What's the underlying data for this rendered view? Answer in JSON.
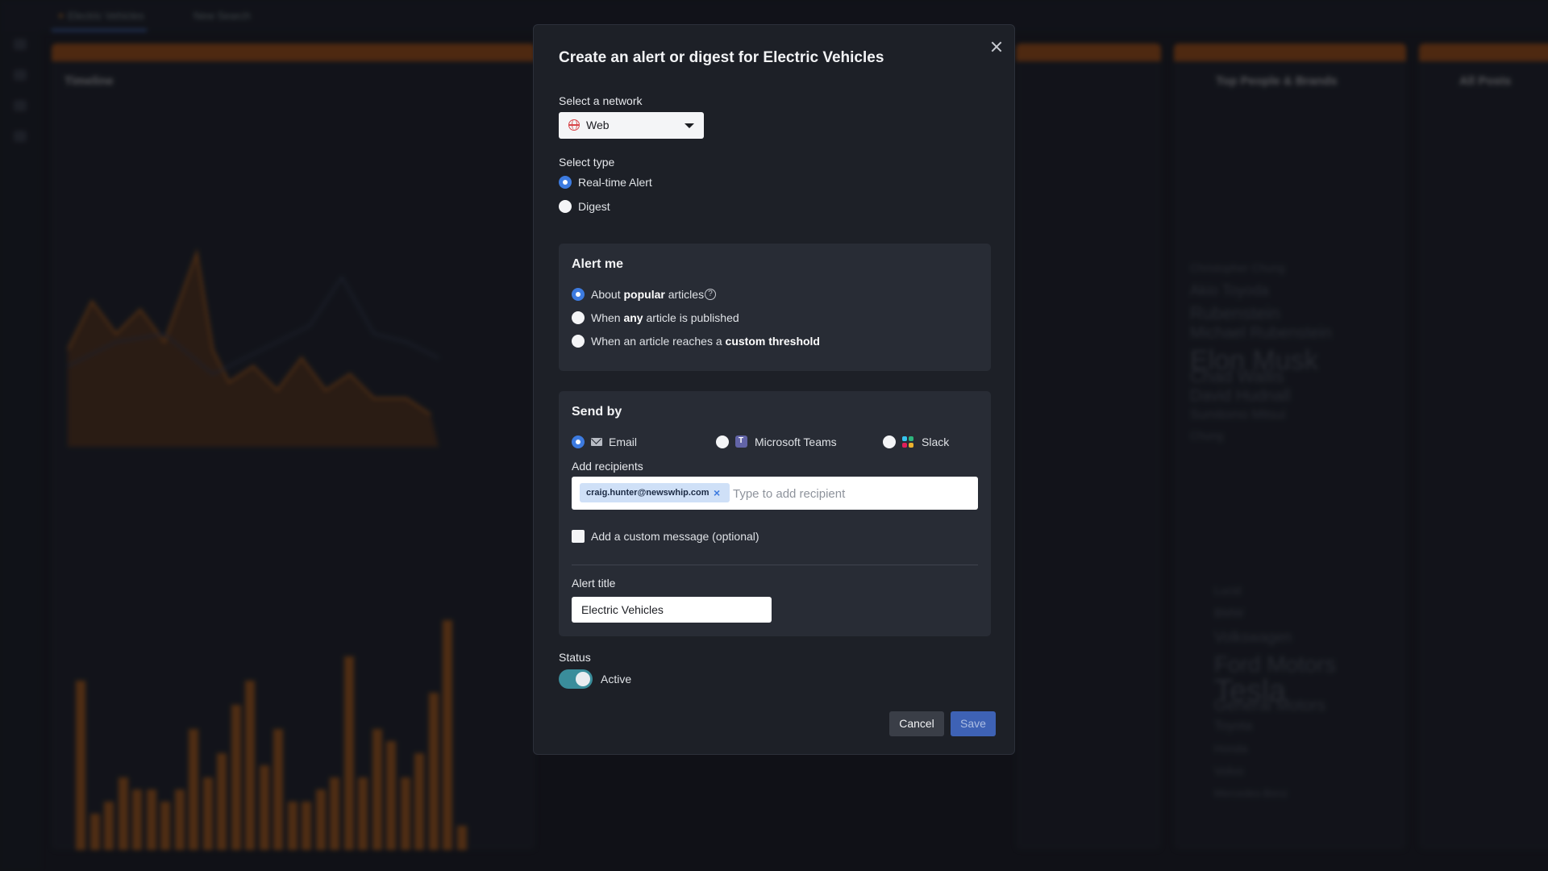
{
  "background": {
    "tab_label": "Electric Vehicles",
    "new_search_label": "New Search",
    "column_titles": [
      "Timeline",
      "Top People & Brands",
      "All Posts"
    ],
    "people_words": [
      "Christopher Chung",
      "Akio Toyoda",
      "Rubenstein",
      "Michael Rubenstein",
      "Elon Musk",
      "Chad Wallis",
      "David Hudnall",
      "Sumitomo Mitsui",
      "Chung"
    ],
    "brand_words": [
      "Lucid",
      "BMW",
      "Volkswagen",
      "Ford Motors",
      "Tesla",
      "General Motors",
      "Toyota",
      "Honda",
      "Volvo",
      "Mercedes-Benz"
    ],
    "bar_values": [
      0.7,
      0.15,
      0.2,
      0.3,
      0.25,
      0.25,
      0.2,
      0.25,
      0.5,
      0.3,
      0.4,
      0.6,
      0.7,
      0.35,
      0.5,
      0.2,
      0.2,
      0.25,
      0.3,
      0.8,
      0.3,
      0.5,
      0.45,
      0.3,
      0.4,
      0.65,
      0.95,
      0.1
    ]
  },
  "modal": {
    "title": "Create an alert or digest for Electric Vehicles",
    "network": {
      "label": "Select a network",
      "selected": "Web",
      "icon": "globe-icon"
    },
    "type": {
      "label": "Select type",
      "options": [
        {
          "label": "Real-time Alert",
          "selected": true
        },
        {
          "label": "Digest",
          "selected": false
        }
      ]
    },
    "alert_me": {
      "title": "Alert me",
      "options": [
        {
          "pre": "About ",
          "bold": "popular",
          "post": " articles",
          "selected": true
        },
        {
          "pre": "When ",
          "bold": "any",
          "post": " article is published",
          "selected": false
        },
        {
          "pre": "When an article reaches a ",
          "bold": "custom threshold",
          "post": "",
          "selected": false
        }
      ]
    },
    "send_by": {
      "title": "Send by",
      "channels": [
        {
          "label": "Email",
          "icon": "mail-icon",
          "selected": true
        },
        {
          "label": "Microsoft Teams",
          "icon": "teams-icon",
          "selected": false
        },
        {
          "label": "Slack",
          "icon": "slack-icon",
          "selected": false
        }
      ],
      "recipients_label": "Add recipients",
      "recipient_chip": "craig.hunter@newswhip.com",
      "recipient_placeholder": "Type to add recipient",
      "custom_message_label": "Add a custom message (optional)",
      "alert_title_label": "Alert title",
      "alert_title_value": "Electric Vehicles"
    },
    "status": {
      "label": "Status",
      "value": "Active",
      "active": true
    },
    "buttons": {
      "cancel": "Cancel",
      "save": "Save"
    },
    "colors": {
      "accent_blue": "#3d7be0",
      "toggle_teal": "#3a8d9b",
      "save_blue": "#3e62b5",
      "background_orange": "#c46512"
    }
  }
}
